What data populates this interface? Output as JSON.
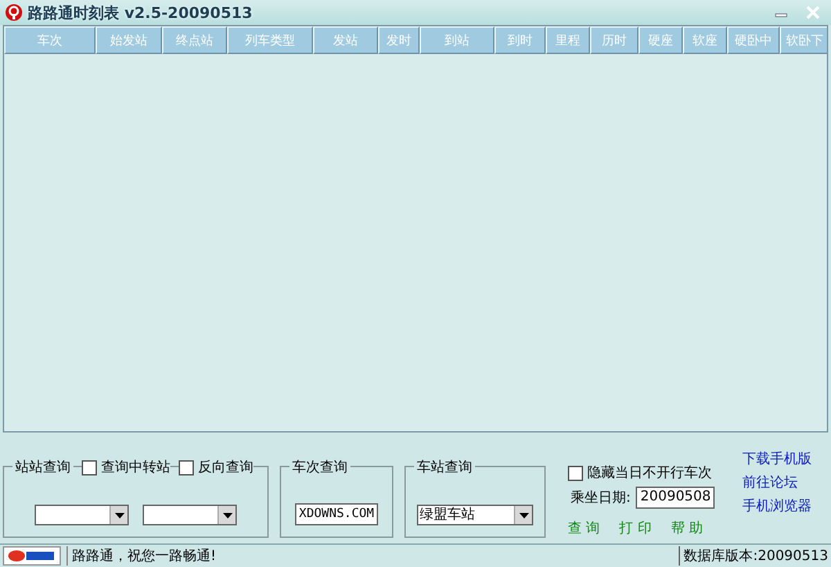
{
  "window": {
    "title": "路路通时刻表 v2.5-20090513"
  },
  "table": {
    "columns": [
      {
        "label": "车次"
      },
      {
        "label": "始发站"
      },
      {
        "label": "终点站"
      },
      {
        "label": "列车类型"
      },
      {
        "label": "发站"
      },
      {
        "label": "发时"
      },
      {
        "label": "到站"
      },
      {
        "label": "到时"
      },
      {
        "label": "里程"
      },
      {
        "label": "历时"
      },
      {
        "label": "硬座"
      },
      {
        "label": "软座"
      },
      {
        "label": "硬卧中"
      },
      {
        "label": "软卧下"
      }
    ]
  },
  "station_query": {
    "title": "站站查询",
    "options": [
      {
        "label": "查询中转站",
        "checked": false
      },
      {
        "label": "反向查询",
        "checked": false
      }
    ]
  },
  "train_query": {
    "title": "车次查询",
    "value": "XDOWNS.COM"
  },
  "station_lookup": {
    "title": "车站查询",
    "value": "绿盟车站"
  },
  "hide_option": {
    "label": "隐藏当日不开行车次",
    "checked": false
  },
  "date": {
    "label": "乘坐日期:",
    "value": "20090508"
  },
  "actions": [
    "查 询",
    "打 印",
    "帮 助"
  ],
  "links": [
    "下载手机版",
    "前往论坛",
    "手机浏览器"
  ],
  "status_bar": {
    "message": "路路通，祝您一路畅通!",
    "version": "数据库版本:20090513"
  }
}
